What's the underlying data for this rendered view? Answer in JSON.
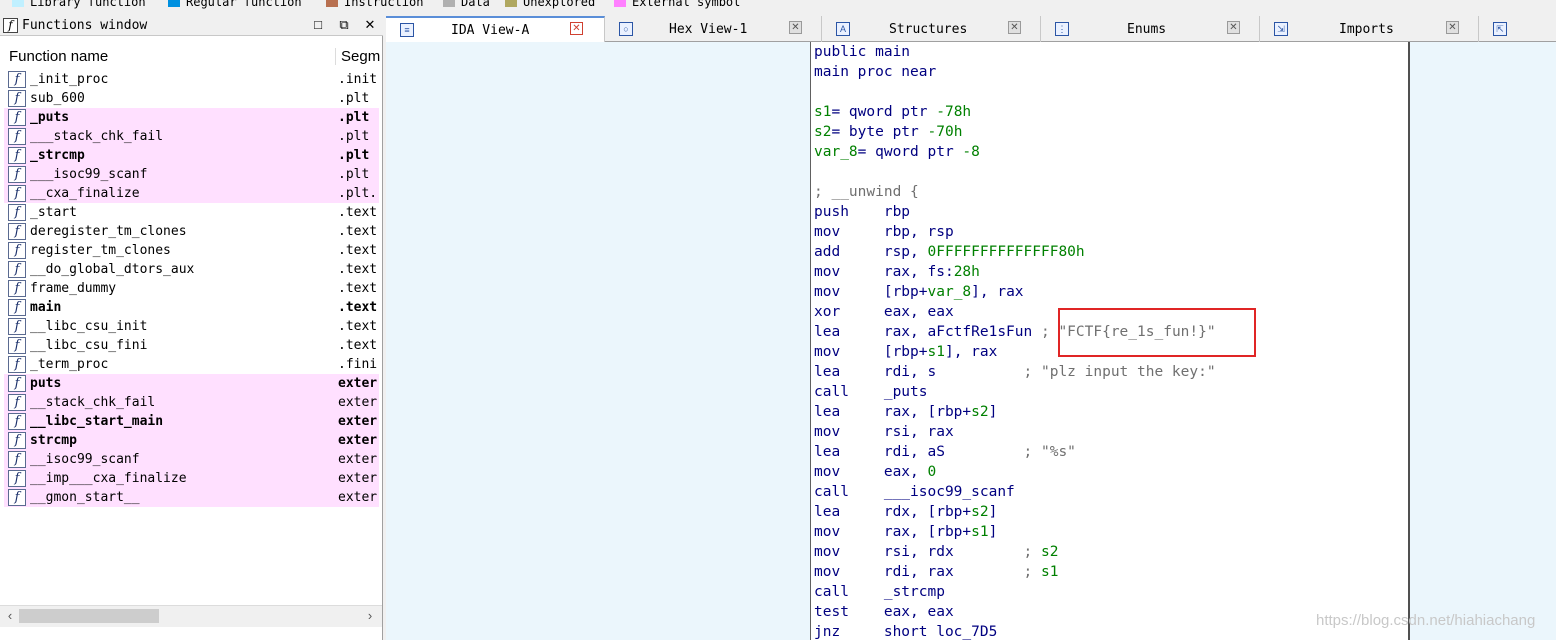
{
  "legend": [
    {
      "label": "Library function",
      "color": "#c0f0ff"
    },
    {
      "label": "Regular function",
      "color": "#0090e0"
    },
    {
      "label": "Instruction",
      "color": "#b87050"
    },
    {
      "label": "Data",
      "color": "#b0b0b0"
    },
    {
      "label": "Unexplored",
      "color": "#b0a860"
    },
    {
      "label": "External symbol",
      "color": "#ff80ff"
    }
  ],
  "functions_window": {
    "title": "Functions window",
    "btn_restore": "□",
    "btn_float": "⧉",
    "btn_close": "✕",
    "col_name": "Function name",
    "col_segment": "Segm",
    "rows": [
      {
        "name": "_init_proc",
        "seg": ".init",
        "lib": false,
        "bold": false
      },
      {
        "name": "sub_600",
        "seg": ".plt",
        "lib": false,
        "bold": false
      },
      {
        "name": "_puts",
        "seg": ".plt",
        "lib": true,
        "bold": true
      },
      {
        "name": "___stack_chk_fail",
        "seg": ".plt",
        "lib": true,
        "bold": false
      },
      {
        "name": "_strcmp",
        "seg": ".plt",
        "lib": true,
        "bold": true
      },
      {
        "name": "___isoc99_scanf",
        "seg": ".plt",
        "lib": true,
        "bold": false
      },
      {
        "name": "__cxa_finalize",
        "seg": ".plt.",
        "lib": true,
        "bold": false
      },
      {
        "name": "_start",
        "seg": ".text",
        "lib": false,
        "bold": false
      },
      {
        "name": "deregister_tm_clones",
        "seg": ".text",
        "lib": false,
        "bold": false
      },
      {
        "name": "register_tm_clones",
        "seg": ".text",
        "lib": false,
        "bold": false
      },
      {
        "name": "__do_global_dtors_aux",
        "seg": ".text",
        "lib": false,
        "bold": false
      },
      {
        "name": "frame_dummy",
        "seg": ".text",
        "lib": false,
        "bold": false
      },
      {
        "name": "main",
        "seg": ".text",
        "lib": false,
        "bold": true
      },
      {
        "name": "__libc_csu_init",
        "seg": ".text",
        "lib": false,
        "bold": false
      },
      {
        "name": "__libc_csu_fini",
        "seg": ".text",
        "lib": false,
        "bold": false
      },
      {
        "name": "_term_proc",
        "seg": ".fini",
        "lib": false,
        "bold": false
      },
      {
        "name": "puts",
        "seg": "exter",
        "lib": true,
        "bold": true
      },
      {
        "name": "__stack_chk_fail",
        "seg": "exter",
        "lib": true,
        "bold": false
      },
      {
        "name": "__libc_start_main",
        "seg": "exter",
        "lib": true,
        "bold": true
      },
      {
        "name": "strcmp",
        "seg": "exter",
        "lib": true,
        "bold": true
      },
      {
        "name": "__isoc99_scanf",
        "seg": "exter",
        "lib": true,
        "bold": false
      },
      {
        "name": "__imp___cxa_finalize",
        "seg": "exter",
        "lib": true,
        "bold": false
      },
      {
        "name": "__gmon_start__",
        "seg": "exter",
        "lib": true,
        "bold": false
      }
    ]
  },
  "tabs": [
    {
      "label": "IDA View-A",
      "active": true
    },
    {
      "label": "Hex View-1",
      "active": false
    },
    {
      "label": "Structures",
      "active": false
    },
    {
      "label": "Enums",
      "active": false
    },
    {
      "label": "Imports",
      "active": false
    }
  ],
  "code": [
    "public main",
    "main proc near",
    "",
    "s1= qword ptr -78h",
    "s2= byte ptr -70h",
    "var_8= qword ptr -8",
    "",
    "; __unwind {",
    "push    rbp",
    "mov     rbp, rsp",
    "add     rsp, 0FFFFFFFFFFFFFF80h",
    "mov     rax, fs:28h",
    "mov     [rbp+var_8], rax",
    "xor     eax, eax",
    "lea     rax, aFctfRe1sFun ; \"FCTF{re_1s_fun!}\"",
    "mov     [rbp+s1], rax",
    "lea     rdi, s          ; \"plz input the key:\"",
    "call    _puts",
    "lea     rax, [rbp+s2]",
    "mov     rsi, rax",
    "lea     rdi, aS         ; \"%s\"",
    "mov     eax, 0",
    "call    ___isoc99_scanf",
    "lea     rdx, [rbp+s2]",
    "mov     rax, [rbp+s1]",
    "mov     rsi, rdx        ; s2",
    "mov     rdi, rax        ; s1",
    "call    _strcmp",
    "test    eax, eax",
    "jnz     short loc_7D5"
  ],
  "watermark": "https://blog.csdn.net/hiahiachang"
}
